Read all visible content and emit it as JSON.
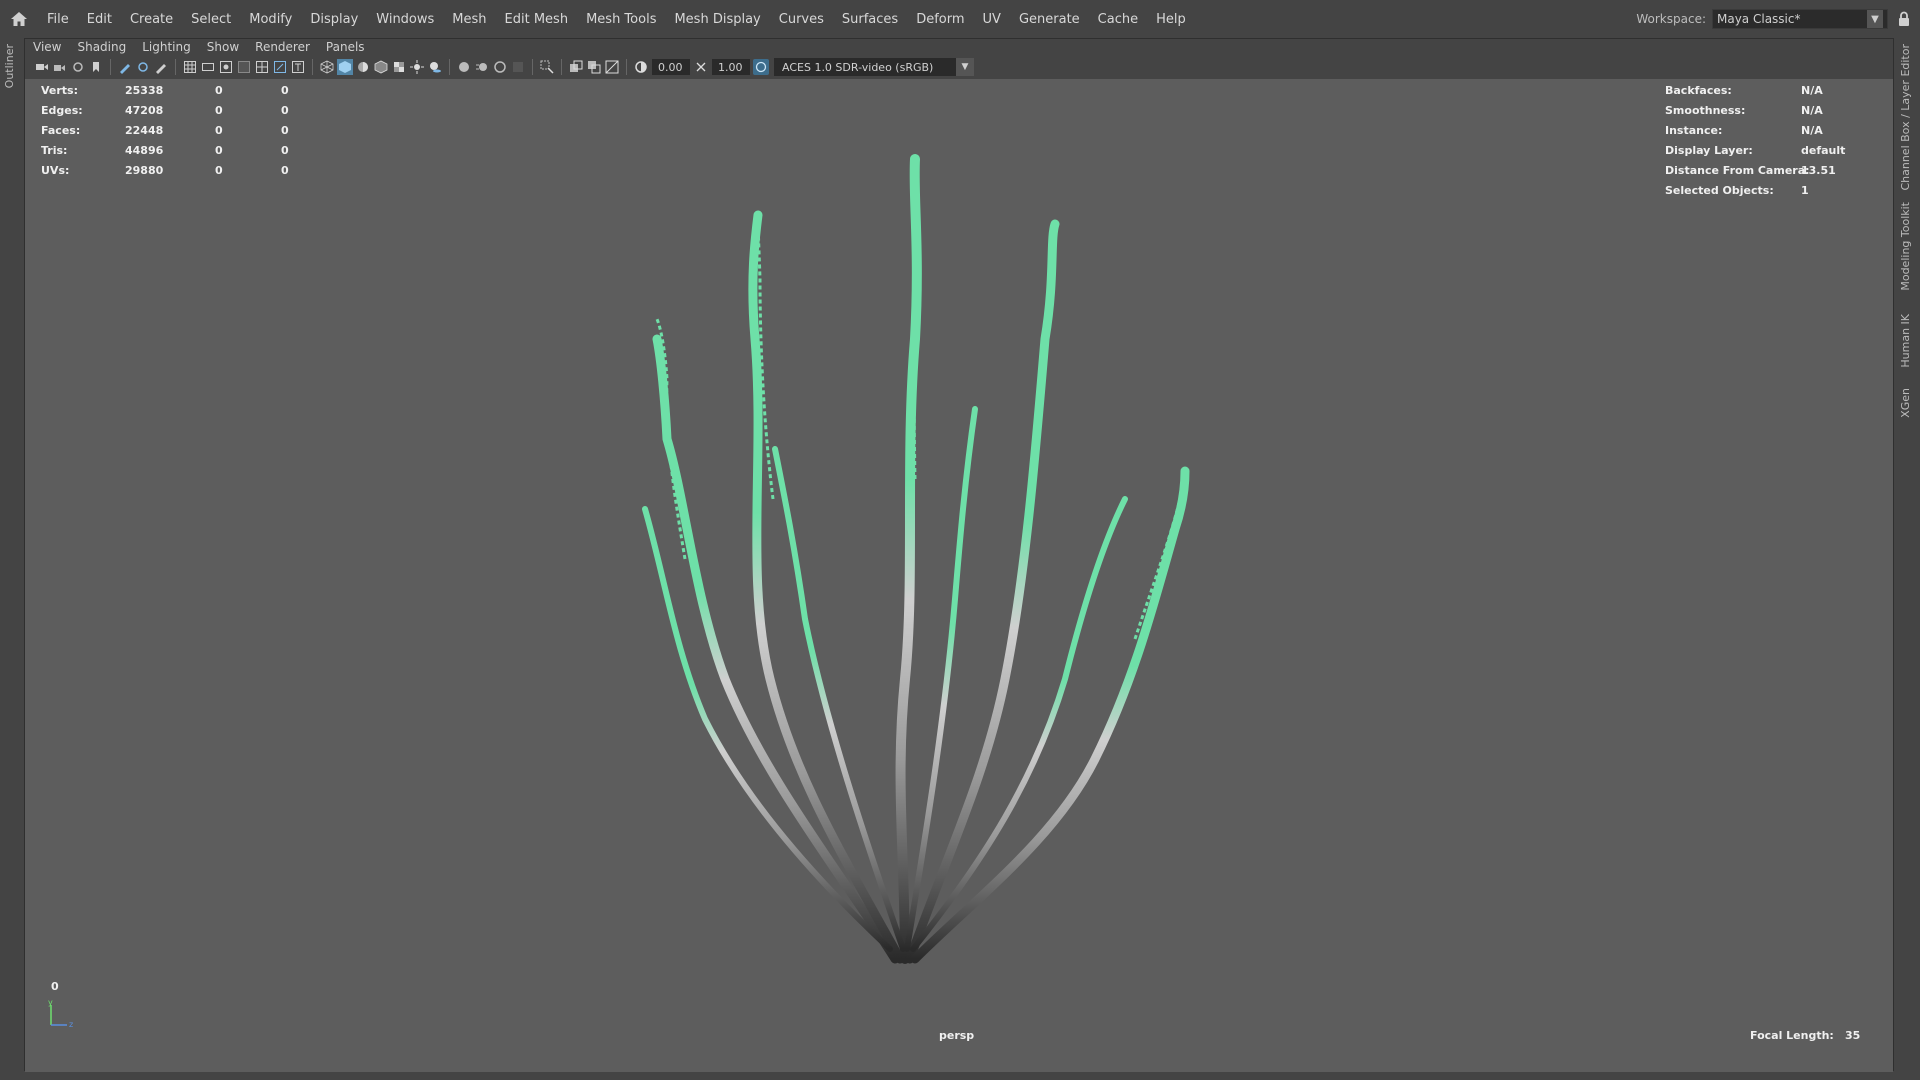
{
  "menubar": {
    "items": [
      "File",
      "Edit",
      "Create",
      "Select",
      "Modify",
      "Display",
      "Windows",
      "Mesh",
      "Edit Mesh",
      "Mesh Tools",
      "Mesh Display",
      "Curves",
      "Surfaces",
      "Deform",
      "UV",
      "Generate",
      "Cache",
      "Help"
    ]
  },
  "workspace": {
    "label": "Workspace:",
    "value": "Maya Classic*"
  },
  "left_sidebar": {
    "outliner": "Outliner"
  },
  "right_sidebar": {
    "tabs": [
      "Channel Box / Layer Editor",
      "Modeling Toolkit",
      "Human IK",
      "XGen"
    ]
  },
  "panel_menus": [
    "View",
    "Shading",
    "Lighting",
    "Show",
    "Renderer",
    "Panels"
  ],
  "toolbar": {
    "exposure": "0.00",
    "gamma": "1.00",
    "color_space": "ACES 1.0 SDR-video (sRGB)"
  },
  "hud_stats": [
    {
      "label": "Verts:",
      "v1": "25338",
      "v2": "0",
      "v3": "0"
    },
    {
      "label": "Edges:",
      "v1": "47208",
      "v2": "0",
      "v3": "0"
    },
    {
      "label": "Faces:",
      "v1": "22448",
      "v2": "0",
      "v3": "0"
    },
    {
      "label": "Tris:",
      "v1": "44896",
      "v2": "0",
      "v3": "0"
    },
    {
      "label": "UVs:",
      "v1": "29880",
      "v2": "0",
      "v3": "0"
    }
  ],
  "hud_info": [
    {
      "label": "Backfaces:",
      "value": "N/A"
    },
    {
      "label": "Smoothness:",
      "value": "N/A"
    },
    {
      "label": "Instance:",
      "value": "N/A"
    },
    {
      "label": "Display Layer:",
      "value": "default"
    },
    {
      "label": "Distance From Camera:",
      "value": "13.51"
    },
    {
      "label": "Selected Objects:",
      "value": "1"
    }
  ],
  "camera": "persp",
  "focal": {
    "label": "Focal Length:",
    "value": "35"
  },
  "frame": "0",
  "colors": {
    "selection": "#6ee0a8",
    "mesh": "#9a9a9a",
    "viewport_bg": "#5d5d5d"
  }
}
